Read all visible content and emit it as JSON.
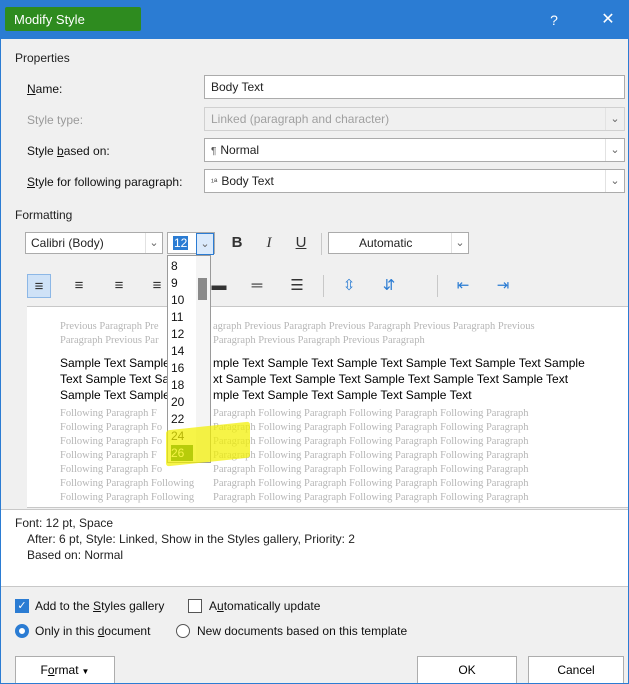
{
  "window": {
    "title": "Modify Style",
    "help_label": "?",
    "close_label": "✕"
  },
  "properties": {
    "section_label": "Properties",
    "name": {
      "label": "Name:",
      "value": "Body Text"
    },
    "style_type": {
      "label": "Style type:",
      "value": "Linked (paragraph and character)"
    },
    "based_on": {
      "label": "Style based on:",
      "icon": "¶",
      "value": "Normal"
    },
    "following": {
      "label": "Style for following paragraph:",
      "icon": "¹ª",
      "value": "Body Text"
    }
  },
  "formatting": {
    "section_label": "Formatting",
    "font": "Calibri (Body)",
    "size": "12",
    "bold": "B",
    "italic": "I",
    "underline": "U",
    "color": "Automatic"
  },
  "size_list": {
    "items": [
      "8",
      "9",
      "10",
      "11",
      "12",
      "14",
      "16",
      "18",
      "20",
      "22",
      "24",
      "26"
    ],
    "selected": "26"
  },
  "preview": {
    "previous": [
      "Previous Paragraph Pre",
      "Paragraph Previous Par"
    ],
    "previous_right": [
      "agraph Previous Paragraph Previous Paragraph Previous Paragraph Previous",
      "Paragraph Previous Paragraph Previous Paragraph"
    ],
    "sample_left": [
      "Sample Text Sample",
      "Text Sample Text Sa",
      "Sample Text Sample"
    ],
    "sample_right": [
      "mple Text Sample Text Sample Text Sample Text Sample Text Sample",
      "xt Sample Text Sample Text Sample Text Sample Text Sample Text",
      "mple Text Sample Text Sample Text Sample Text"
    ],
    "following_left": [
      "Following Paragraph F",
      "Following Paragraph Fo",
      "Following Paragraph Fo",
      "Following Paragraph F",
      "Following Paragraph Fo",
      "Following Paragraph Following",
      "Following Paragraph Following"
    ],
    "following_right": [
      "Paragraph Following Paragraph Following Paragraph Following Paragraph",
      "Paragraph Following Paragraph Following Paragraph Following Paragraph",
      "Paragraph Following Paragraph Following Paragraph Following Paragraph",
      "Paragraph Following Paragraph Following Paragraph Following Paragraph",
      "Paragraph Following Paragraph Following Paragraph Following Paragraph",
      "Paragraph Following Paragraph Following Paragraph Following Paragraph",
      "Paragraph Following Paragraph Following Paragraph Following Paragraph"
    ]
  },
  "description": {
    "line1": "Font: 12 pt, Space",
    "line2": "After:  6 pt, Style: Linked, Show in the Styles gallery, Priority: 2",
    "line3": "Based on: Normal"
  },
  "options": {
    "add_gallery": "Add to the Styles gallery",
    "auto_update": "Automatically update",
    "only_doc": "Only in this document",
    "new_docs": "New documents based on this template"
  },
  "buttons": {
    "format": "Format",
    "ok": "OK",
    "cancel": "Cancel"
  },
  "colors": {
    "accent": "#2b7cd3",
    "title_highlight": "#2e8b1f",
    "marker": "#f2f000",
    "selected_item": "#1f6f25"
  }
}
